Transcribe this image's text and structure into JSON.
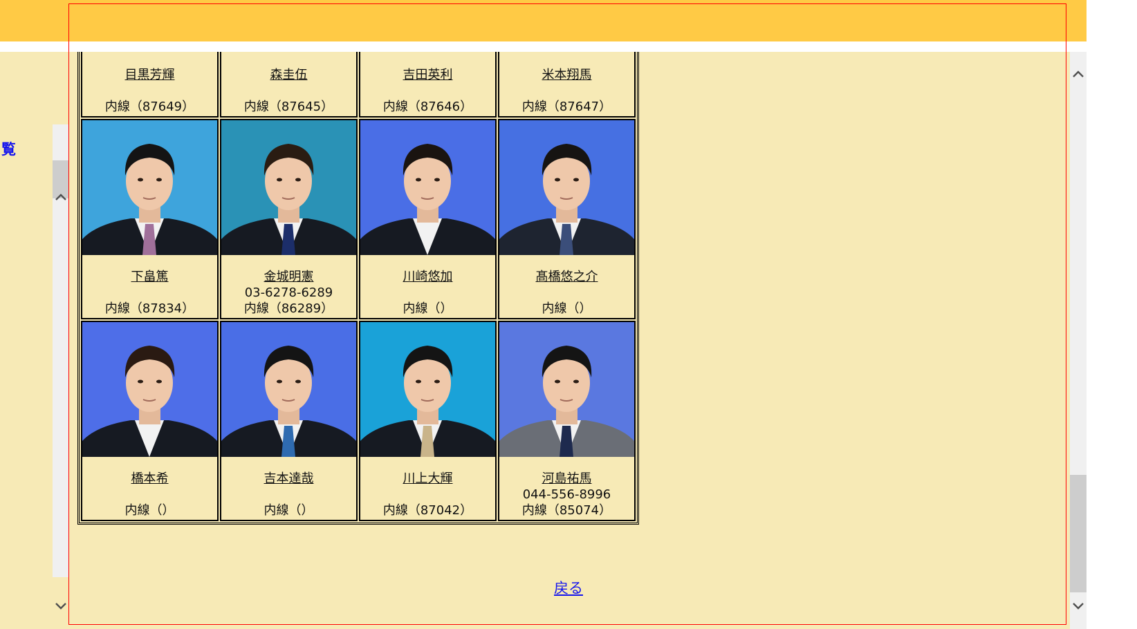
{
  "left_nav": {
    "link_text": "覧"
  },
  "staff_rows": [
    [
      {
        "name": "目黒芳輝",
        "phone": "",
        "extension": "内線（87649）",
        "photo": {
          "bg": "#1c2b45",
          "suit": "#15181f",
          "tie": "#3d5a9a"
        }
      },
      {
        "name": "森圭伍",
        "phone": "",
        "extension": "内線（87645）",
        "photo": {
          "bg": "#1c2b45",
          "suit": "#15181f",
          "tie": "#3d5a9a"
        }
      },
      {
        "name": "吉田英利",
        "phone": "",
        "extension": "内線（87646）",
        "photo": {
          "bg": "#1c2b45",
          "suit": "#15181f",
          "tie": "#3d5a9a"
        }
      },
      {
        "name": "米本翔馬",
        "phone": "",
        "extension": "内線（87647）",
        "photo": {
          "bg": "#1c2b45",
          "suit": "#15181f",
          "tie": "#8a1e2a"
        }
      }
    ],
    [
      {
        "name": "下畠篤",
        "phone": "",
        "extension": "内線（87834）",
        "photo": {
          "bg": "#3ea4dc",
          "suit": "#161a22",
          "tie": "#a0709a",
          "hair": "#141414"
        }
      },
      {
        "name": "金城明憲",
        "phone": "03-6278-6289",
        "extension": "内線（86289）",
        "photo": {
          "bg": "#2a92b6",
          "suit": "#161a22",
          "tie": "#1c2e6a",
          "hair": "#2a1c12"
        }
      },
      {
        "name": "川崎悠加",
        "phone": "",
        "extension": "内線（）",
        "photo": {
          "bg": "#4a6ee6",
          "suit": "#161a22",
          "tie": "",
          "hair": "#1a1410"
        }
      },
      {
        "name": "髙橋悠之介",
        "phone": "",
        "extension": "内線（）",
        "photo": {
          "bg": "#4670e2",
          "suit": "#1e2430",
          "tie": "#3b4e7a",
          "hair": "#161412"
        }
      }
    ],
    [
      {
        "name": "橋本希",
        "phone": "",
        "extension": "内線（）",
        "photo": {
          "bg": "#4e6ee8",
          "suit": "#161a22",
          "tie": "",
          "hair": "#2a1a12"
        }
      },
      {
        "name": "吉本達哉",
        "phone": "",
        "extension": "内線（）",
        "photo": {
          "bg": "#4a6ee6",
          "suit": "#161a22",
          "tie": "#2f6bb0",
          "hair": "#141414"
        }
      },
      {
        "name": "川上大輝",
        "phone": "",
        "extension": "内線（87042）",
        "photo": {
          "bg": "#1aa2d8",
          "suit": "#161a22",
          "tie": "#c9b48a",
          "hair": "#141414"
        }
      },
      {
        "name": "河島祐馬",
        "phone": "044-556-8996",
        "extension": "内線（85074）",
        "photo": {
          "bg": "#5a78e0",
          "suit": "#6a6e76",
          "tie": "#1e2a4e",
          "hair": "#141414"
        }
      }
    ]
  ],
  "back_link": "戻る"
}
